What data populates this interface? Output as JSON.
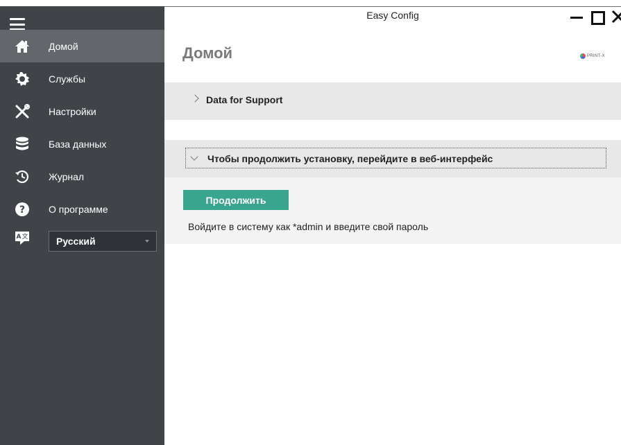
{
  "window": {
    "title": "Easy Config"
  },
  "sidebar": {
    "items": [
      {
        "label": "Домой",
        "icon": "home-icon",
        "active": true
      },
      {
        "label": "Службы",
        "icon": "gear-icon",
        "active": false
      },
      {
        "label": "Настройки",
        "icon": "tools-icon",
        "active": false
      },
      {
        "label": "База данных",
        "icon": "database-icon",
        "active": false
      },
      {
        "label": "Журнал",
        "icon": "history-icon",
        "active": false
      },
      {
        "label": "О программе",
        "icon": "help-icon",
        "active": false
      }
    ],
    "language": {
      "icon": "translate-icon",
      "selected": "Русский"
    }
  },
  "main": {
    "page_title": "Домой",
    "brand_logo_text": "PRINT-X",
    "support_panel": {
      "label": "Data for Support",
      "expanded": false
    },
    "install_panel": {
      "label": "Чтобы продолжить установку, перейдите в веб-интерфейс",
      "expanded": true,
      "button_label": "Продолжить",
      "hint": "Войдите в систему как *admin и введите свой пароль"
    }
  },
  "colors": {
    "sidebar_bg": "#404348",
    "sidebar_active": "#63666b",
    "accent": "#3aa58f",
    "panel_bg": "#e8e8e8"
  }
}
